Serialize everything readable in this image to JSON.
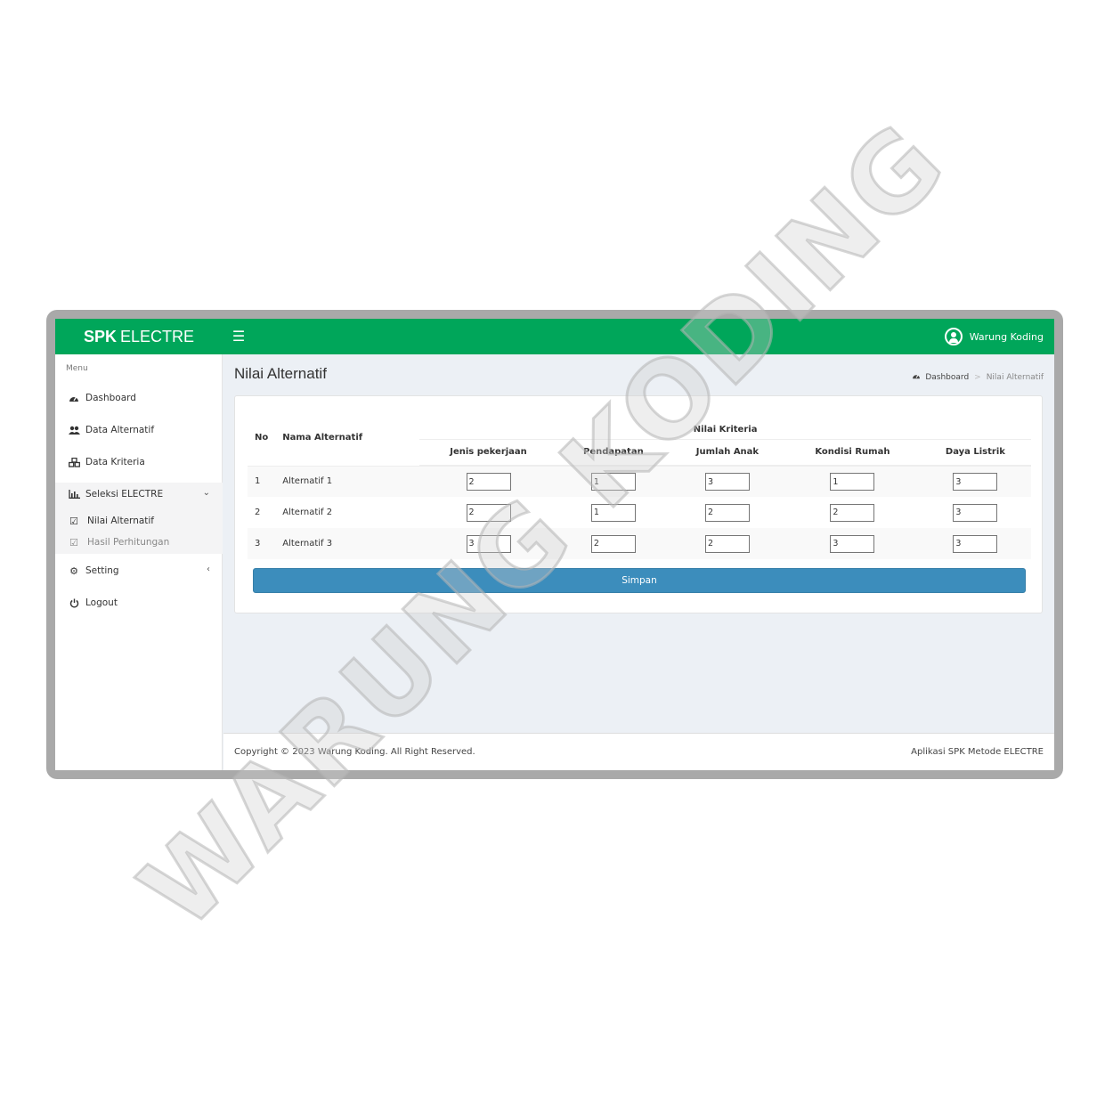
{
  "app": {
    "logo_bold": "SPK",
    "logo_rest": "ELECTRE"
  },
  "header": {
    "user_name": "Warung Koding",
    "menu_toggle_icon": "hamburger-icon"
  },
  "sidebar": {
    "menu_label": "Menu",
    "items": [
      {
        "label": "Dashboard",
        "icon": "dashboard-icon"
      },
      {
        "label": "Data Alternatif",
        "icon": "users-icon"
      },
      {
        "label": "Data Kriteria",
        "icon": "cubes-icon"
      },
      {
        "label": "Seleksi ELECTRE",
        "icon": "bar-chart-icon"
      },
      {
        "label": "Setting",
        "icon": "gear-icon"
      },
      {
        "label": "Logout",
        "icon": "power-icon"
      }
    ],
    "sub_items": [
      {
        "label": "Nilai Alternatif",
        "icon": "check-square-icon"
      },
      {
        "label": "Hasil Perhitungan",
        "icon": "check-square-icon"
      }
    ]
  },
  "page": {
    "title": "Nilai Alternatif",
    "breadcrumb": [
      "Dashboard",
      "Nilai Alternatif"
    ]
  },
  "table": {
    "col_no": "No",
    "col_name": "Nama Alternatif",
    "group_header": "Nilai Kriteria",
    "criteria": [
      "Jenis pekerjaan",
      "Pendapatan",
      "Jumlah Anak",
      "Kondisi Rumah",
      "Daya Listrik"
    ],
    "rows": [
      {
        "no": "1",
        "name": "Alternatif 1",
        "values": [
          "2",
          "1",
          "3",
          "1",
          "3"
        ]
      },
      {
        "no": "2",
        "name": "Alternatif 2",
        "values": [
          "2",
          "1",
          "2",
          "2",
          "3"
        ]
      },
      {
        "no": "3",
        "name": "Alternatif 3",
        "values": [
          "3",
          "2",
          "2",
          "3",
          "3"
        ]
      }
    ]
  },
  "form": {
    "submit_label": "Simpan"
  },
  "footer": {
    "copyright": "Copyright © 2023 Warung Koding. All Right Reserved.",
    "app_name": "Aplikasi SPK Metode ELECTRE"
  },
  "watermark": {
    "text": "WARUNG KODING"
  }
}
